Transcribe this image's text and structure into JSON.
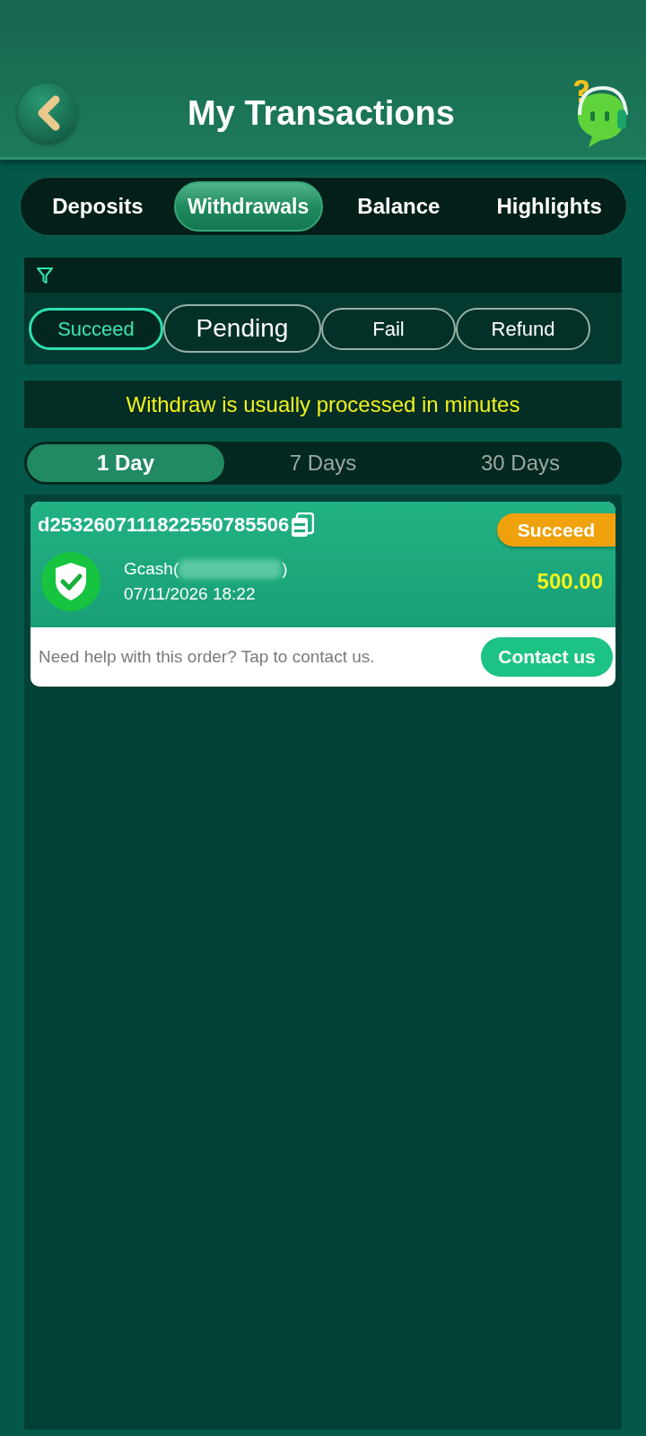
{
  "header": {
    "title": "My Transactions"
  },
  "tabs": [
    {
      "label": "Deposits",
      "selected": false
    },
    {
      "label": "Withdrawals",
      "selected": true
    },
    {
      "label": "Balance",
      "selected": false
    },
    {
      "label": "Highlights",
      "selected": false
    }
  ],
  "status_filters": [
    {
      "label": "Succeed",
      "selected": true,
      "enlarged": false
    },
    {
      "label": "Pending",
      "selected": false,
      "enlarged": true
    },
    {
      "label": "Fail",
      "selected": false,
      "enlarged": false
    },
    {
      "label": "Refund",
      "selected": false,
      "enlarged": false
    }
  ],
  "notice": "Withdraw is usually processed in minutes",
  "periods": [
    {
      "label": "1 Day",
      "selected": true
    },
    {
      "label": "7 Days",
      "selected": false
    },
    {
      "label": "30 Days",
      "selected": false
    }
  ],
  "transactions": [
    {
      "order_id": "d2532607111822550785506",
      "status": "Succeed",
      "account_prefix": "Gcash(",
      "account_suffix": ")",
      "time": "07/11/2026 18:22",
      "amount": "500.00",
      "help_text": "Need help with this order? Tap to contact us.",
      "contact_button": "Contact us"
    }
  ]
}
